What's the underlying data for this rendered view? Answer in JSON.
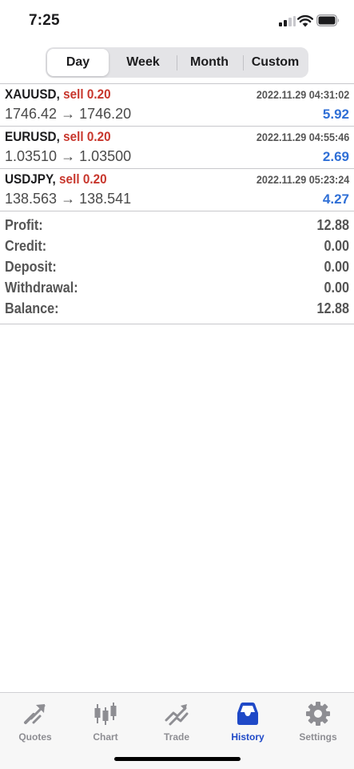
{
  "status_bar": {
    "time": "7:25"
  },
  "period_tabs": [
    {
      "label": "Day",
      "active": true
    },
    {
      "label": "Week",
      "active": false
    },
    {
      "label": "Month",
      "active": false
    },
    {
      "label": "Custom",
      "active": false
    }
  ],
  "deals": [
    {
      "symbol": "XAUUSD,",
      "side": "sell 0.20",
      "time": "2022.11.29 04:31:02",
      "prices": "1746.42 → 1746.20",
      "profit": "5.92"
    },
    {
      "symbol": "EURUSD,",
      "side": "sell 0.20",
      "time": "2022.11.29 04:55:46",
      "prices": "1.03510 → 1.03500",
      "profit": "2.69"
    },
    {
      "symbol": "USDJPY,",
      "side": "sell 0.20",
      "time": "2022.11.29 05:23:24",
      "prices": "138.563 → 138.541",
      "profit": "4.27"
    }
  ],
  "summary": [
    {
      "label": "Profit:",
      "value": "12.88"
    },
    {
      "label": "Credit:",
      "value": "0.00"
    },
    {
      "label": "Deposit:",
      "value": "0.00"
    },
    {
      "label": "Withdrawal:",
      "value": "0.00"
    },
    {
      "label": "Balance:",
      "value": "12.88"
    }
  ],
  "tabbar": [
    {
      "label": "Quotes",
      "icon": "quotes-icon",
      "active": false
    },
    {
      "label": "Chart",
      "icon": "candlestick-chart-icon",
      "active": false
    },
    {
      "label": "Trade",
      "icon": "trade-icon",
      "active": false
    },
    {
      "label": "History",
      "icon": "inbox-tray-icon",
      "active": true
    },
    {
      "label": "Settings",
      "icon": "gear-icon",
      "active": false
    }
  ],
  "colors": {
    "sell": "#c8372d",
    "profit": "#2f6fd6",
    "tab_active": "#1f49c7",
    "tab_inactive": "#8e8e93"
  }
}
